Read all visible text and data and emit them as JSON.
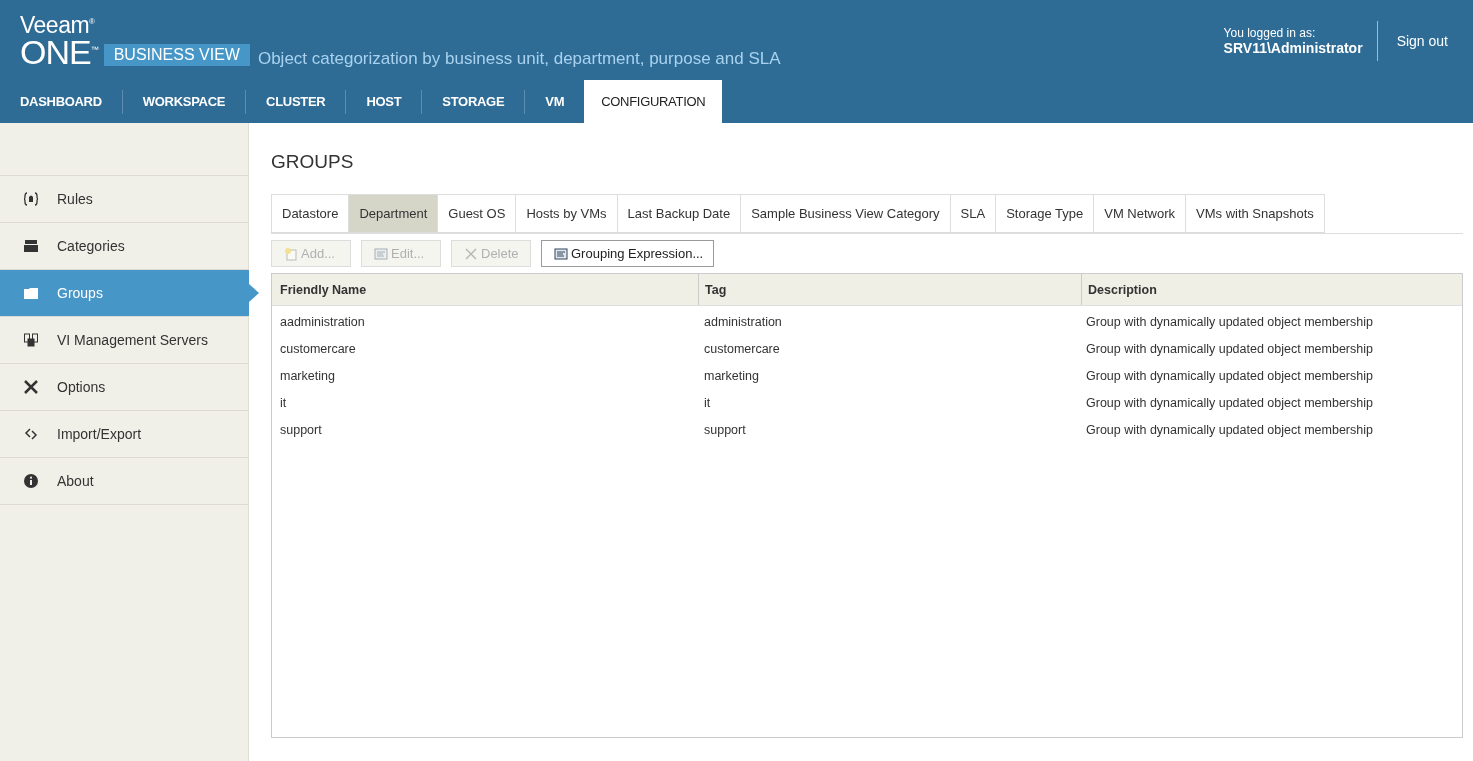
{
  "header": {
    "logo_top": "Veeam$^{®}$",
    "logo_bottom": "ONE$^{™}$",
    "product": "BUSINESS VIEW",
    "tagline": "Object categorization by business unit, department, purpose and SLA",
    "login_label": "You logged in as:",
    "user": "SRV11\\Administrator",
    "sign_out": "Sign out"
  },
  "nav": [
    {
      "label": "DASHBOARD",
      "selected": false
    },
    {
      "label": "WORKSPACE",
      "selected": false
    },
    {
      "label": "CLUSTER",
      "selected": false
    },
    {
      "label": "HOST",
      "selected": false
    },
    {
      "label": "STORAGE",
      "selected": false
    },
    {
      "label": "VM",
      "selected": false
    },
    {
      "label": "CONFIGURATION",
      "selected": true
    }
  ],
  "sidebar": {
    "items": [
      {
        "label": "Rules",
        "kind": "rules",
        "selected": false
      },
      {
        "label": "Categories",
        "kind": "categories",
        "selected": false
      },
      {
        "label": "Groups",
        "kind": "groups",
        "selected": true
      },
      {
        "label": "VI Management Servers",
        "kind": "servers",
        "selected": false
      },
      {
        "label": "Options",
        "kind": "options",
        "selected": false
      },
      {
        "label": "Import/Export",
        "kind": "import",
        "selected": false
      },
      {
        "label": "About",
        "kind": "about",
        "selected": false
      }
    ]
  },
  "page_title": "GROUPS",
  "tabs": [
    {
      "label": "Datastore",
      "selected": false
    },
    {
      "label": "Department",
      "selected": true
    },
    {
      "label": "Guest OS",
      "selected": false
    },
    {
      "label": "Hosts by VMs",
      "selected": false
    },
    {
      "label": "Last Backup Date",
      "selected": false
    },
    {
      "label": "Sample Business View Category",
      "selected": false
    },
    {
      "label": "SLA",
      "selected": false
    },
    {
      "label": "Storage Type",
      "selected": false
    },
    {
      "label": "VM Network",
      "selected": false
    },
    {
      "label": "VMs with Snapshots",
      "selected": false
    }
  ],
  "toolbar": [
    {
      "label": "Add...",
      "kind": "add",
      "disabled": true
    },
    {
      "label": "Edit...",
      "kind": "edit",
      "disabled": true
    },
    {
      "label": "Delete",
      "kind": "delete",
      "disabled": true
    },
    {
      "label": "Grouping Expression...",
      "kind": "expression",
      "disabled": false
    }
  ],
  "table": {
    "columns": [
      "Friendly Name",
      "Tag",
      "Description"
    ],
    "rows": [
      [
        "aadministration",
        "administration",
        "Group with dynamically updated object membership"
      ],
      [
        "customercare",
        "customercare",
        "Group with dynamically updated object membership"
      ],
      [
        "marketing",
        "marketing",
        "Group with dynamically updated object membership"
      ],
      [
        "it",
        "it",
        "Group with dynamically updated object membership"
      ],
      [
        "support",
        "support",
        "Group with dynamically updated object membership"
      ]
    ]
  }
}
